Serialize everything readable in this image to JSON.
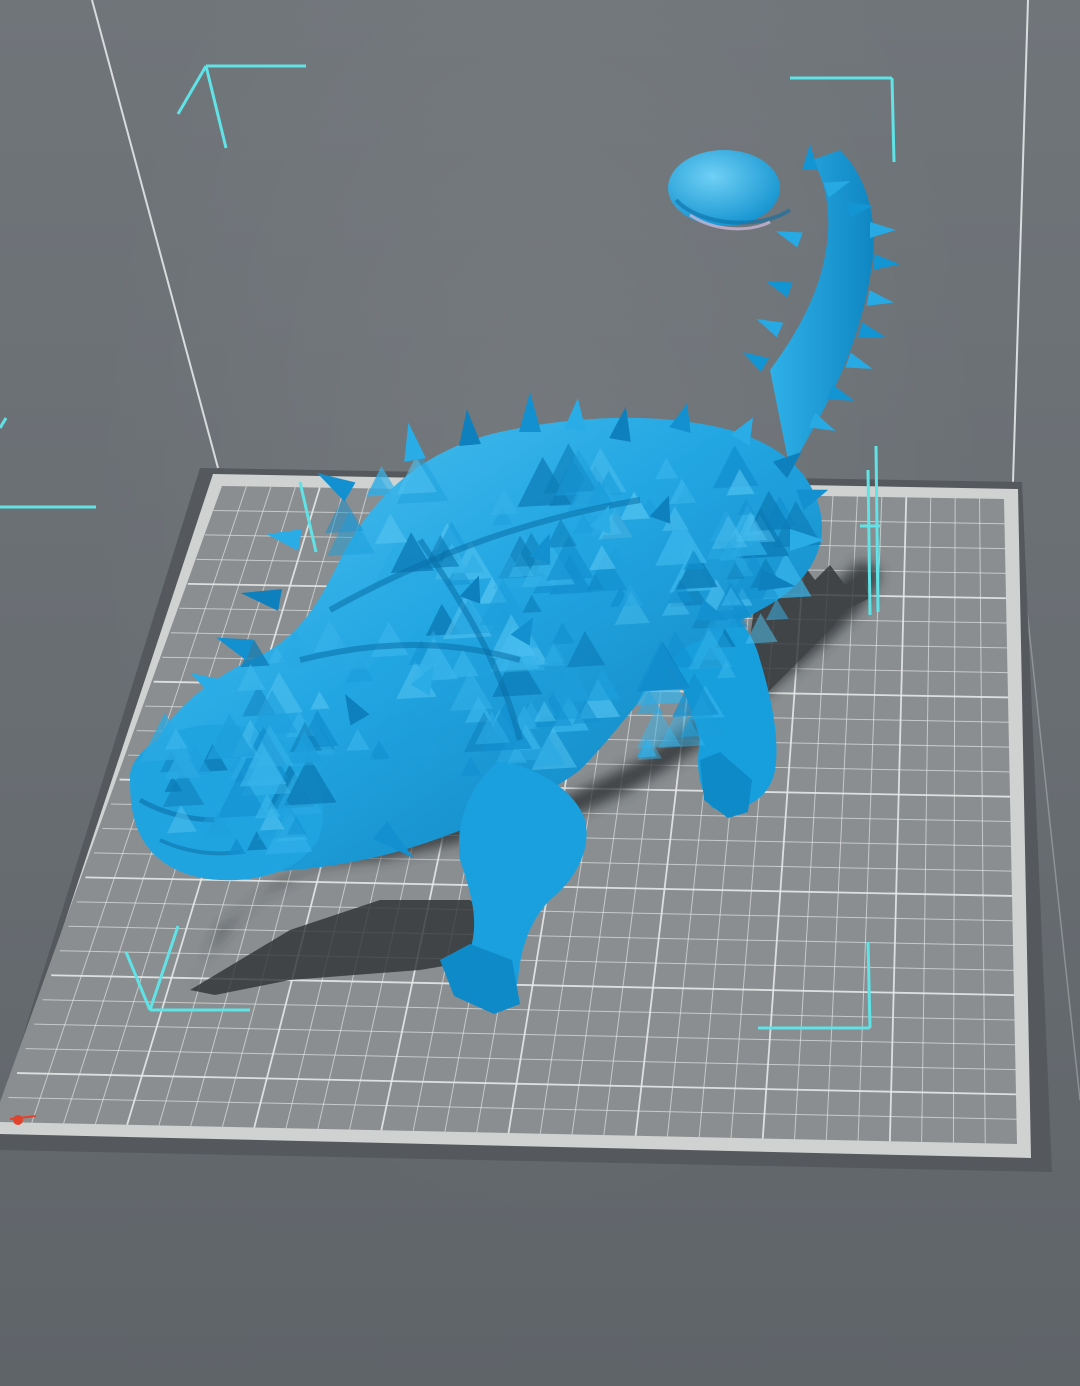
{
  "viewport": {
    "background_color": "#6b7075",
    "build_volume_edge_color": "#d9dcdc",
    "wall_color": "#6c7176"
  },
  "build_plate": {
    "plate_color": "#8a8e90",
    "plate_rim_color": "#cfd2d1",
    "grid_line_color": "#e6e8e8",
    "base_shadow_color": "#54585c"
  },
  "model": {
    "name_icon": "ankylosaurus-model-icon",
    "color": "#1fa3e0",
    "highlight_color": "#53c3f1",
    "shade_color": "#0b78b4",
    "shadow_color": "#2f3235"
  },
  "selection_frame": {
    "color": "#5fe3e6",
    "icons": [
      "corner-bracket-top-left-icon",
      "corner-bracket-top-right-icon",
      "corner-bracket-bottom-left-icon",
      "corner-bracket-bottom-right-icon"
    ]
  },
  "origin_marker": {
    "color": "#e0432e",
    "icon": "origin-axis-marker-icon"
  }
}
